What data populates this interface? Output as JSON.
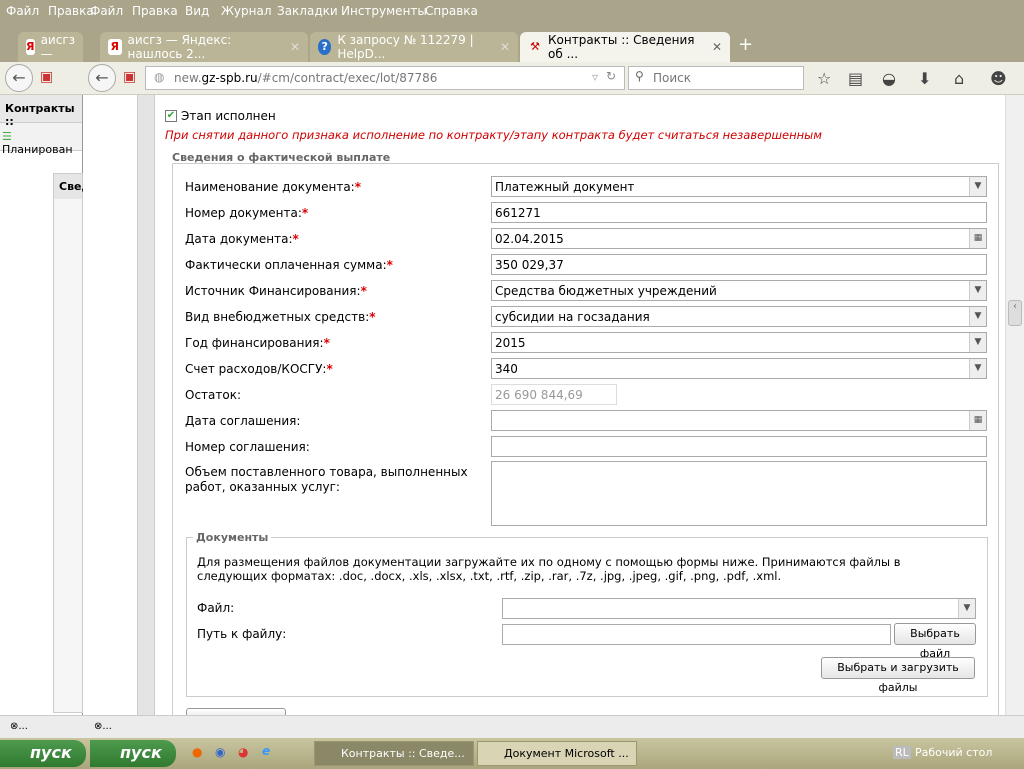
{
  "back_window": {
    "menu": [
      "Файл",
      "Правка"
    ],
    "tab_label": "аисгз —",
    "page_title": "Контракты ::",
    "nav_item": "Планирован",
    "panel_title": "Свед",
    "status": "⊗..."
  },
  "menu": [
    "Файл",
    "Правка",
    "Вид",
    "Журнал",
    "Закладки",
    "Инструменты",
    "Справка"
  ],
  "tabs": [
    {
      "label": "аисгз — Яндекс: нашлось 2...",
      "icon": "yandex-icon"
    },
    {
      "label": "К запросу № 112279 | HelpD...",
      "icon": "help-icon"
    },
    {
      "label": "Контракты :: Сведения об ...",
      "icon": "hammer-icon",
      "active": true
    }
  ],
  "url": {
    "domain": "new.gz-spb.ru",
    "host_prefix": "new.",
    "host_main": "gz-spb.ru",
    "path": "/#cm/contract/exec/lot/87786"
  },
  "search_placeholder": "Поиск",
  "form": {
    "stage_done_label": "Этап исполнен",
    "stage_done_checked": true,
    "warning": "При снятии данного признака исполнение по контракту/этапу контракта будет считаться незавершенным",
    "section_title": "Сведения о фактической выплате",
    "fields": [
      {
        "label": "Наименование документа:",
        "required": true,
        "value": "Платежный документ",
        "type": "select"
      },
      {
        "label": "Номер документа:",
        "required": true,
        "value": "661271",
        "type": "text"
      },
      {
        "label": "Дата документа:",
        "required": true,
        "value": "02.04.2015",
        "type": "date"
      },
      {
        "label": "Фактически оплаченная сумма:",
        "required": true,
        "value": "350 029,37",
        "type": "text"
      },
      {
        "label": "Источник Финансирования:",
        "required": true,
        "value": "Средства бюджетных учреждений",
        "type": "select"
      },
      {
        "label": "Вид внебюджетных средств:",
        "required": true,
        "value": "субсидии на госзадания",
        "type": "select"
      },
      {
        "label": "Год финансирования:",
        "required": true,
        "value": "2015",
        "type": "select"
      },
      {
        "label": "Счет расходов/КОСГУ:",
        "required": true,
        "value": "340",
        "type": "select"
      },
      {
        "label": "Остаток:",
        "required": false,
        "value": "26 690 844,69",
        "type": "readonly"
      },
      {
        "label": "Дата соглашения:",
        "required": false,
        "value": "",
        "type": "date"
      },
      {
        "label": "Номер соглашения:",
        "required": false,
        "value": "",
        "type": "text"
      }
    ],
    "volume_label": "Объем поставленного товара, выполненных работ, оказанных услуг:",
    "volume_value": "",
    "docs": {
      "title": "Документы",
      "hint": "Для размещения файлов документации загружайте их по одному с помощью формы ниже. Принимаются файлы в следующих форматах: .doc, .docx, .xls, .xlsx, .txt, .rtf, .zip, .rar, .7z, .jpg, .jpeg, .gif, .png, .pdf, .xml.",
      "file_label": "Файл:",
      "path_label": "Путь к файлу:",
      "choose_file": "Выбрать файл",
      "choose_upload": "Выбрать и загрузить файлы"
    }
  },
  "status": "⊗...",
  "taskbar": {
    "start": "пуск",
    "windows": [
      "Контракты :: Сведе...",
      "Документ Microsoft ..."
    ],
    "lang": "RL",
    "desktop": "Рабочий стол"
  },
  "colors": {
    "warning": "#d00000",
    "chrome": "#a9a48a",
    "start": "#3a8a3a"
  }
}
